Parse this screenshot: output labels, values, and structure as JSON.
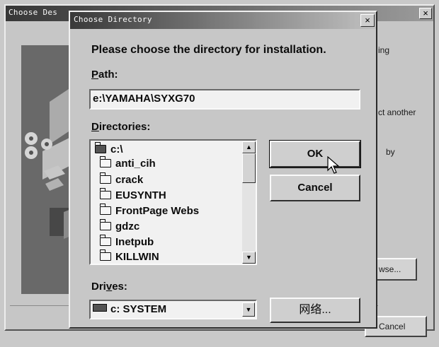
{
  "background_window": {
    "title": "Choose Des",
    "close_label": "×",
    "text_fragments": [
      "ing",
      "ct another",
      "by"
    ],
    "browse_label": "wse...",
    "cancel_label": "Cancel"
  },
  "dialog": {
    "title": "Choose Directory",
    "close_label": "×",
    "heading": "Please choose the directory for installation.",
    "path_label_ul": "P",
    "path_label_rest": "ath:",
    "path_value": "e:\\YAMAHA\\SYXG70",
    "directories_label_ul": "D",
    "directories_label_rest": "irectories:",
    "directories": [
      {
        "name": "c:\\",
        "open": true
      },
      {
        "name": "anti_cih",
        "open": false
      },
      {
        "name": "crack",
        "open": false
      },
      {
        "name": "EUSYNTH",
        "open": false
      },
      {
        "name": "FrontPage Webs",
        "open": false
      },
      {
        "name": "gdzc",
        "open": false
      },
      {
        "name": "Inetpub",
        "open": false
      },
      {
        "name": "KILLWIN",
        "open": false
      }
    ],
    "ok_label": "OK",
    "cancel_label": "Cancel",
    "drives_label_pre": "Dri",
    "drives_label_ul": "v",
    "drives_label_post": "es:",
    "drive_value": "c: SYSTEM",
    "network_label": "网络..."
  },
  "colors": {
    "title_dark": "#3c3c3c",
    "title_light": "#bdbdbd",
    "face": "#c4c4c4"
  }
}
